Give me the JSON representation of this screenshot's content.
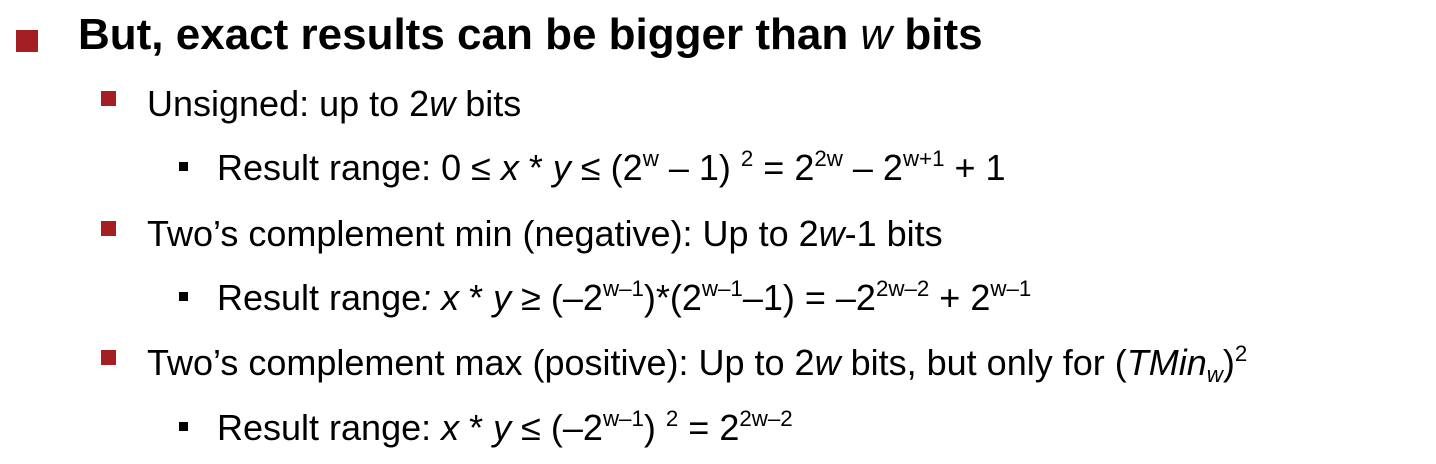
{
  "colors": {
    "bullet": "#a31f24",
    "text": "#000000"
  },
  "heading": {
    "text_before": "But, exact results can be bigger than ",
    "var": "w",
    "text_after": " bits"
  },
  "unsigned": {
    "label_a": "Unsigned: up to 2",
    "var": "w",
    "label_b": " bits",
    "result": {
      "label": "Result range: 0 ≤ ",
      "x": "x",
      "op": " * ",
      "y": "y",
      "rest_a": " ≤ (2",
      "exp1": "w",
      "rest_b": " – 1) ",
      "exp2": "2",
      "rest_c": "  =  2",
      "exp3": "2w",
      "rest_d": " – 2",
      "exp4": "w+1",
      "rest_e": " + 1"
    }
  },
  "twos_min": {
    "label_a": "Two’s complement min (negative): Up to 2",
    "var": "w",
    "label_b": "-1 bits",
    "result": {
      "label": "Result range",
      "colon": ": ",
      "x": "x",
      "op": " * ",
      "y": "y",
      "rest_a": "  ≥ (–2",
      "exp1": "w–1",
      "rest_b": ")*(2",
      "exp2": "w–1",
      "rest_c": "–1)  =  –2",
      "exp3": "2w–2",
      "rest_d": " + 2",
      "exp4": "w–1"
    }
  },
  "twos_max": {
    "label_a": "Two’s complement max (positive): Up to 2",
    "var": "w",
    "label_b": " bits, but only for (",
    "tmin": "TMin",
    "tmin_sub": "w",
    "close": ")",
    "exp": "2",
    "result": {
      "label": "Result range: ",
      "x": "x",
      "op": " * ",
      "y": "y",
      "rest_a": " ≤ (–2",
      "exp1": "w–1",
      "rest_b": ") ",
      "exp2": "2",
      "rest_c": "  =  2",
      "exp3": "2w–2"
    }
  }
}
